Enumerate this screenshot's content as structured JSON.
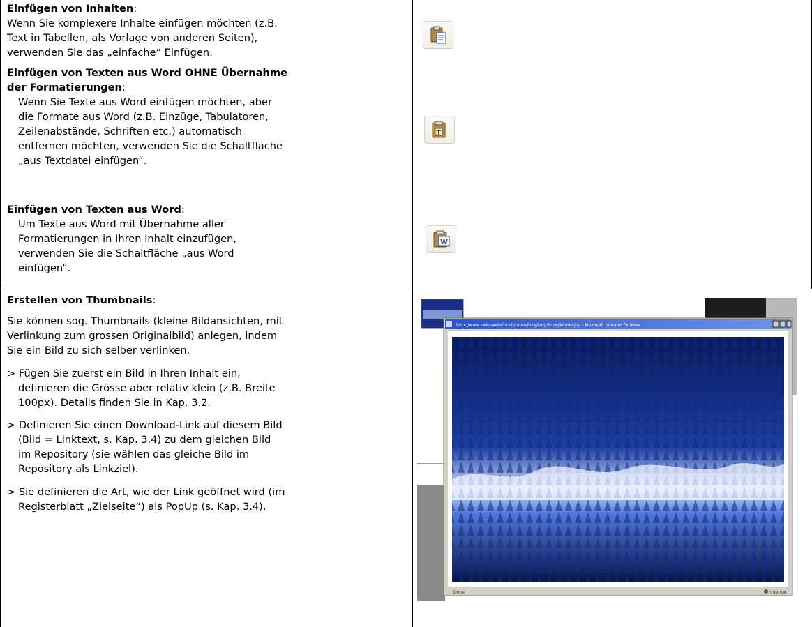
{
  "section1": {
    "head1": "Einfügen von Inhalten",
    "colon": ":",
    "p1": [
      "Wenn Sie komplexere Inhalte einfügen möchten (z.B.",
      "Text in Tabellen, als Vorlage von anderen Seiten),",
      "verwenden Sie das „einfache“ Einfügen."
    ],
    "head2a": "Einfügen von Texten aus Word OHNE Übernahme",
    "head2b": "der Formatierungen",
    "p2": [
      "Wenn Sie Texte aus Word einfügen möchten, aber",
      "die Formate aus Word (z.B. Einzüge, Tabulatoren,",
      "Zeilenabstände, Schriften etc.) automatisch",
      "entfernen möchten, verwenden Sie die Schaltfläche",
      "„aus Textdatei einfügen“."
    ],
    "head3": "Einfügen von Texten aus Word",
    "p3": [
      "Um Texte aus Word mit Übernahme aller",
      "Formatierungen in Ihren Inhalt einzufügen,",
      "verwenden Sie die Schaltfläche „aus Word",
      "einfügen“."
    ],
    "icons": [
      "paste-icon",
      "paste-text-icon",
      "paste-word-icon"
    ]
  },
  "section2": {
    "head": "Erstellen von Thumbnails",
    "colon": ":",
    "intro": [
      "Sie können sog. Thumbnails (kleine Bildansichten, mit",
      "Verlinkung zum grossen Originalbild) anlegen, indem",
      "Sie ein Bild zu sich selber verlinken."
    ],
    "step1": [
      "> Fügen Sie zuerst ein Bild in Ihren Inhalt ein,",
      "definieren die Grösse aber relativ klein (z.B. Breite",
      "100px). Details finden Sie in Kap. 3.2."
    ],
    "step2": [
      "> Definieren Sie einen Download-Link auf diesem Bild",
      "(Bild = Linktext, s. Kap. 3.4) zu dem gleichen Bild",
      "im Repository (sie wählen das gleiche Bild im",
      "Repository als Linkziel)."
    ],
    "step3": [
      "> Sie definieren die Art, wie der Link geöffnet wird (im",
      "Registerblatt „Zielseite“) als PopUp (s. Kap. 3.4)."
    ]
  },
  "popup": {
    "title": "http://www.swisswebsite.ch/repository/tmp/fotos/Winter.jpg - Microsoft Internet Explorer",
    "status_left": "Done",
    "status_right": "Internet"
  },
  "colors": {
    "border": "#000000",
    "forest_dark": "#0a1f66",
    "forest_light": "#2f5fd1",
    "window_blue": "#3a5fc8"
  }
}
